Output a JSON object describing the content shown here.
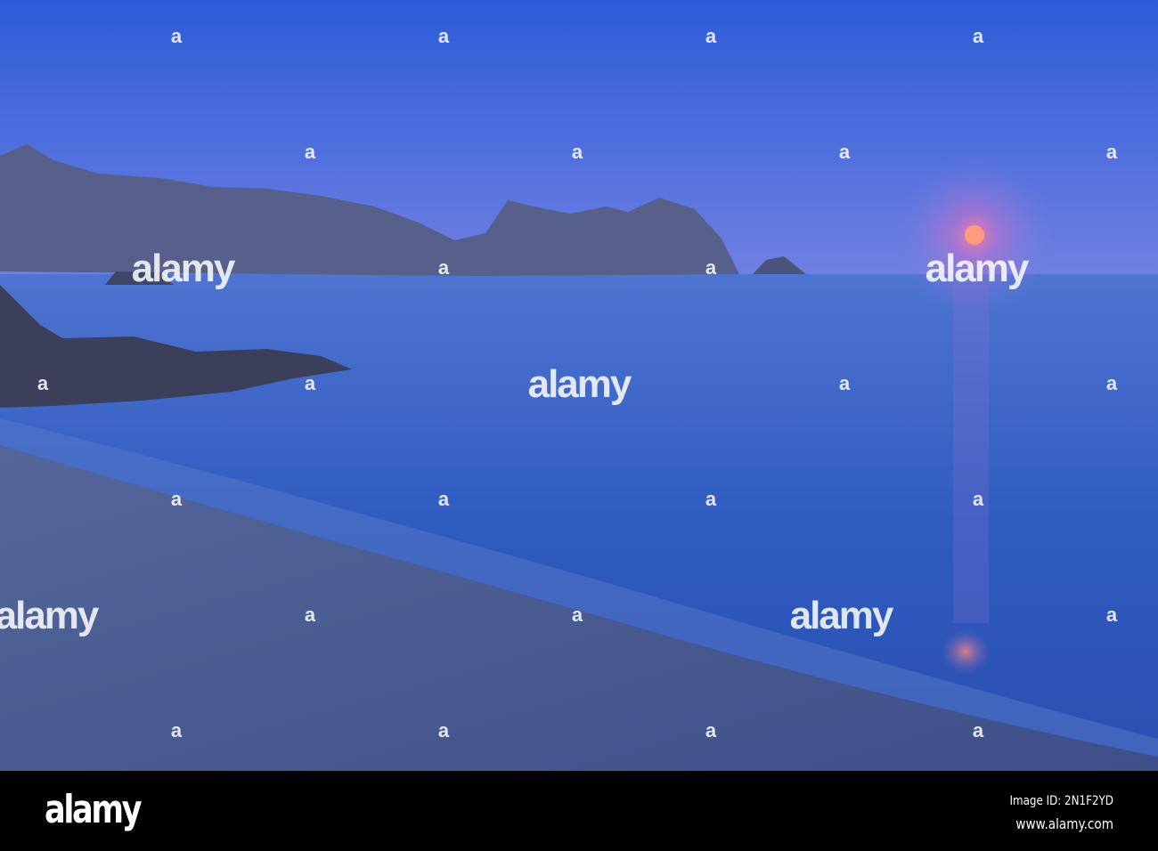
{
  "photo": {
    "subject": "moonrise",
    "colors": {
      "sky_top": "#2f5fd8",
      "horizon": "#6a7fe0",
      "sea": "#2c55b8",
      "sand": "#4a5e8f",
      "moon": "#ff9a7a"
    }
  },
  "watermark": {
    "text": "alamy"
  },
  "footer": {
    "logo": "alamy",
    "image_id": "Image ID: 2N1F2YD",
    "url": "www.alamy.com"
  }
}
